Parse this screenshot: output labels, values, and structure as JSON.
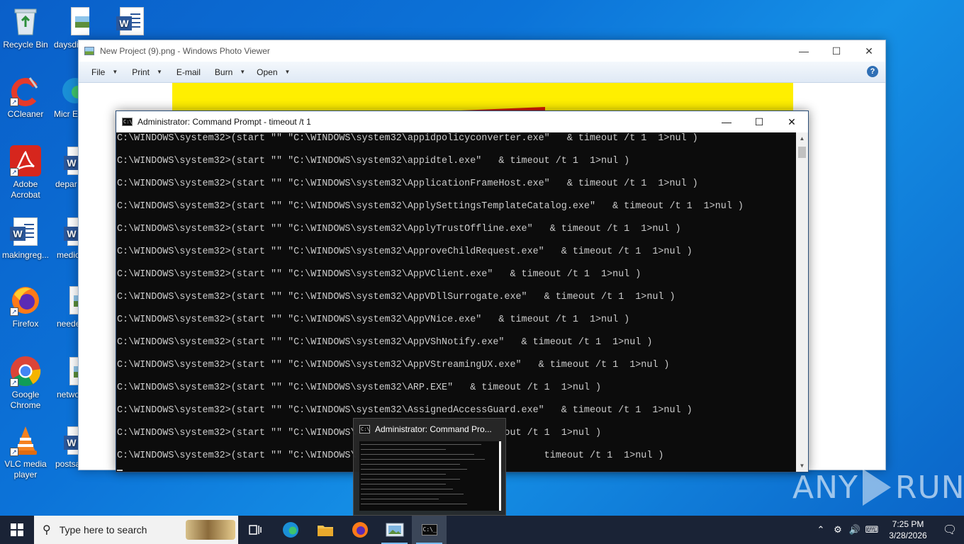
{
  "desktop": {
    "icons": [
      {
        "label": "Recycle Bin",
        "icon": "recycle-bin-icon"
      },
      {
        "label": "daysdi",
        "icon": "image-file-icon"
      },
      {
        "label": "",
        "icon": "word-document-icon"
      },
      {
        "label": "CCleaner",
        "icon": "ccleaner-icon"
      },
      {
        "label": "Micr Ec",
        "icon": "edge-icon"
      },
      {
        "label": "Adobe Acrobat",
        "icon": "acrobat-icon"
      },
      {
        "label": "depar",
        "icon": "word-document-icon"
      },
      {
        "label": "makingreg...",
        "icon": "word-document-icon"
      },
      {
        "label": "medic",
        "icon": "word-document-icon"
      },
      {
        "label": "Firefox",
        "icon": "firefox-icon"
      },
      {
        "label": "neede",
        "icon": "image-file-icon"
      },
      {
        "label": "Google Chrome",
        "icon": "chrome-icon"
      },
      {
        "label": "netwo",
        "icon": "image-file-icon"
      },
      {
        "label": "VLC media player",
        "icon": "vlc-icon"
      },
      {
        "label": "postsa",
        "icon": "word-document-icon"
      }
    ]
  },
  "photo_viewer": {
    "title": "New Project (9).png - Windows Photo Viewer",
    "menu": [
      "File",
      "Print",
      "E-mail",
      "Burn",
      "Open"
    ]
  },
  "cmd": {
    "title": "Administrator: Command Prompt - timeout  /t 1",
    "lines": [
      "C:\\WINDOWS\\system32>(start \"\" \"C:\\WINDOWS\\system32\\appidpolicyconverter.exe\"   & timeout /t 1  1>nul )",
      "C:\\WINDOWS\\system32>(start \"\" \"C:\\WINDOWS\\system32\\appidtel.exe\"   & timeout /t 1  1>nul )",
      "C:\\WINDOWS\\system32>(start \"\" \"C:\\WINDOWS\\system32\\ApplicationFrameHost.exe\"   & timeout /t 1  1>nul )",
      "C:\\WINDOWS\\system32>(start \"\" \"C:\\WINDOWS\\system32\\ApplySettingsTemplateCatalog.exe\"   & timeout /t 1  1>nul )",
      "C:\\WINDOWS\\system32>(start \"\" \"C:\\WINDOWS\\system32\\ApplyTrustOffline.exe\"   & timeout /t 1  1>nul )",
      "C:\\WINDOWS\\system32>(start \"\" \"C:\\WINDOWS\\system32\\ApproveChildRequest.exe\"   & timeout /t 1  1>nul )",
      "C:\\WINDOWS\\system32>(start \"\" \"C:\\WINDOWS\\system32\\AppVClient.exe\"   & timeout /t 1  1>nul )",
      "C:\\WINDOWS\\system32>(start \"\" \"C:\\WINDOWS\\system32\\AppVDllSurrogate.exe\"   & timeout /t 1  1>nul )",
      "C:\\WINDOWS\\system32>(start \"\" \"C:\\WINDOWS\\system32\\AppVNice.exe\"   & timeout /t 1  1>nul )",
      "C:\\WINDOWS\\system32>(start \"\" \"C:\\WINDOWS\\system32\\AppVShNotify.exe\"   & timeout /t 1  1>nul )",
      "C:\\WINDOWS\\system32>(start \"\" \"C:\\WINDOWS\\system32\\AppVStreamingUX.exe\"   & timeout /t 1  1>nul )",
      "C:\\WINDOWS\\system32>(start \"\" \"C:\\WINDOWS\\system32\\ARP.EXE\"   & timeout /t 1  1>nul )",
      "C:\\WINDOWS\\system32>(start \"\" \"C:\\WINDOWS\\system32\\AssignedAccessGuard.exe\"   & timeout /t 1  1>nul )",
      "C:\\WINDOWS\\system32>(start \"\" \"C:\\WINDOWS\\                          out /t 1  1>nul )",
      "C:\\WINDOWS\\system32>(start \"\" \"C:\\WINDOWS\\                                 timeout /t 1  1>nul )"
    ]
  },
  "task_preview": {
    "title": "Administrator: Command Pro..."
  },
  "watermark": {
    "text_left": "ANY",
    "text_right": "RUN"
  },
  "taskbar": {
    "search_placeholder": "Type here to search",
    "apps": [
      "task-view-icon",
      "edge-icon",
      "file-explorer-icon",
      "firefox-icon",
      "photo-viewer-icon",
      "command-prompt-icon"
    ],
    "time": "7:25 PM",
    "date": "3/28/2026"
  },
  "colors": {
    "desktop_bg": "#0c73d8",
    "console_bg": "#0c0c0c",
    "console_fg": "#cccccc",
    "taskbar_bg": "#1a2336",
    "photo_yellow": "#ffef00",
    "photo_red": "#d81e05"
  }
}
